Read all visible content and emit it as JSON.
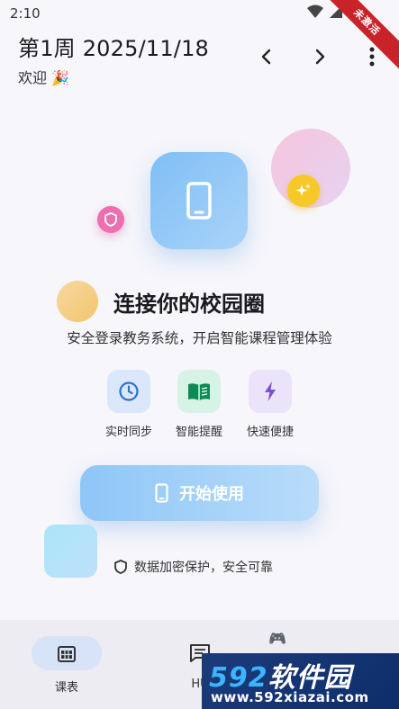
{
  "status_bar": {
    "time": "2:10",
    "ribbon": "未激活"
  },
  "header": {
    "week_title": "第1周 2025/11/18",
    "welcome": "欢迎 🎉"
  },
  "hero": {
    "title": "连接你的校园圈",
    "subtitle": "安全登录教务系统，开启智能课程管理体验"
  },
  "features": [
    {
      "label": "实时同步",
      "icon": "clock-icon",
      "bg": "#dbe8fb",
      "color": "#2f6fd0"
    },
    {
      "label": "智能提醒",
      "icon": "book-icon",
      "bg": "#d6f3e6",
      "color": "#0e8a55"
    },
    {
      "label": "快速便捷",
      "icon": "bolt-icon",
      "bg": "#ebe3fa",
      "color": "#7b4fd6"
    }
  ],
  "start_button": {
    "label": "开始使用"
  },
  "secure_note": "数据加密保护，安全可靠",
  "bottom_nav": [
    {
      "label": "课表",
      "active": true,
      "icon": "calendar-grid-icon"
    },
    {
      "label": "HU",
      "active": false,
      "icon": "message-icon"
    }
  ],
  "watermark": {
    "brand_num": "592",
    "brand_text": "软件园",
    "url": "www.592xiazai.com"
  },
  "colors": {
    "accent_blue": "#8fc6f8",
    "background": "#f6f6fb",
    "nav_active": "#d7e3f7"
  }
}
